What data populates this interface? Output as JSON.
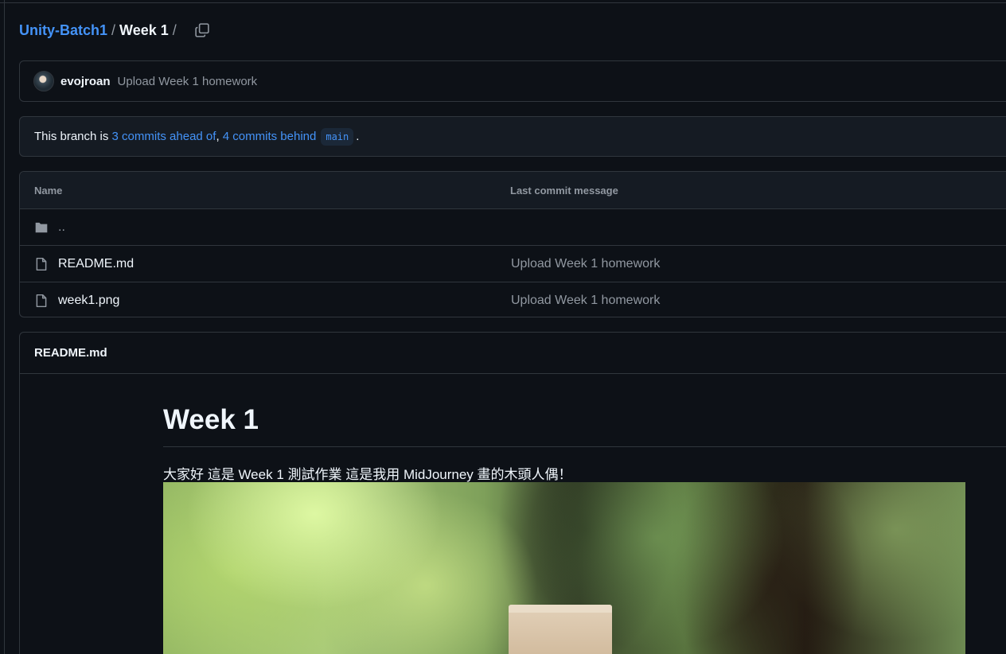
{
  "breadcrumb": {
    "repo": "Unity-Batch1",
    "separator": "/",
    "current": "Week 1",
    "trailing_separator": "/"
  },
  "commit": {
    "author": "evojroan",
    "message": "Upload Week 1 homework"
  },
  "branch_status": {
    "prefix": "This branch is ",
    "ahead": "3 commits ahead of",
    "comma": ", ",
    "behind": "4 commits behind",
    "base": "main",
    "suffix": "."
  },
  "files": {
    "headers": {
      "name": "Name",
      "last_commit": "Last commit message"
    },
    "rows": [
      {
        "name": "..",
        "type": "folder",
        "commit": ""
      },
      {
        "name": "README.md",
        "type": "file",
        "commit": "Upload Week 1 homework"
      },
      {
        "name": "week1.png",
        "type": "file",
        "commit": "Upload Week 1 homework"
      }
    ]
  },
  "readme": {
    "title": "README.md",
    "heading": "Week 1",
    "paragraph": "大家好 這是 Week 1 測試作業 這是我用 MidJourney 畫的木頭人偶！"
  },
  "icons": {
    "copy": "copy-icon",
    "folder": "folder-icon",
    "file": "file-icon"
  },
  "colors": {
    "background": "#0d1117",
    "link": "#4493f8",
    "muted": "#9198a1",
    "border": "#30363d"
  }
}
